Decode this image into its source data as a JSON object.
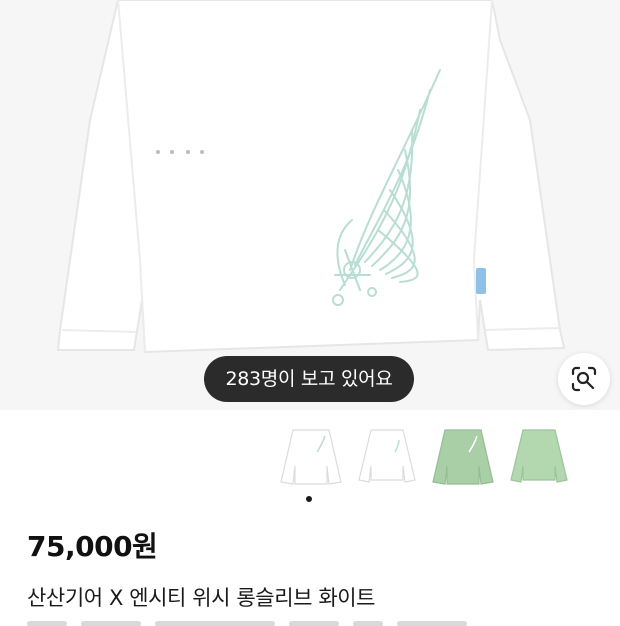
{
  "product": {
    "viewer_badge": "283명이 보고 있어요",
    "price": "75,000원",
    "title": "산산기어 X 엔시티 위시 롱슬리브 화이트",
    "variants": [
      {
        "name": "white-front",
        "color": "#ffffff"
      },
      {
        "name": "white-back",
        "color": "#ffffff"
      },
      {
        "name": "green-front",
        "color": "#a9cfa7"
      },
      {
        "name": "green-back",
        "color": "#b3d8b0"
      }
    ],
    "active_image_index": 0
  },
  "icons": {
    "lens": "lens-search-icon"
  },
  "colors": {
    "badge_bg": "#2b2b2b",
    "hero_bg": "#f6f6f7",
    "print_green": "#b8ddd3"
  }
}
